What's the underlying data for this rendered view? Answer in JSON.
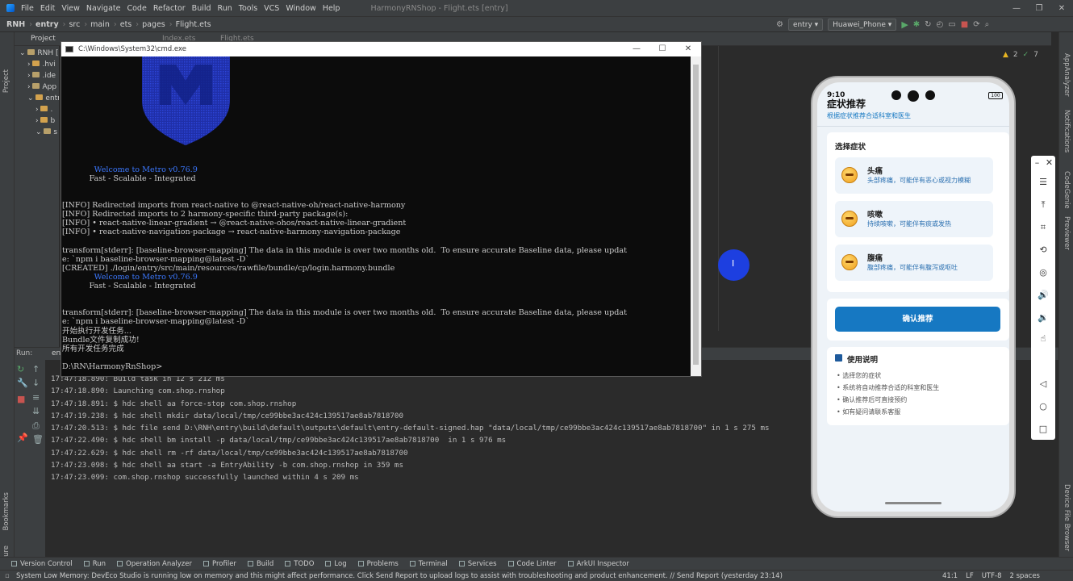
{
  "menubar": {
    "items": [
      "File",
      "Edit",
      "View",
      "Navigate",
      "Code",
      "Refactor",
      "Build",
      "Run",
      "Tools",
      "VCS",
      "Window",
      "Help"
    ],
    "title": "HarmonyRNShop - Flight.ets [entry]"
  },
  "navbar": {
    "crumbs": [
      "RNH",
      "entry",
      "src",
      "main",
      "ets",
      "pages",
      "Flight.ets"
    ],
    "module_select": "entry",
    "device_select": "Huawei_Phone"
  },
  "project": {
    "header": "Project",
    "tree": [
      "RNH [H",
      ".hvi",
      ".ide",
      "App",
      "entr",
      ".",
      "b",
      "s"
    ]
  },
  "editor": {
    "tabs": [
      "Index.ets",
      "Flight.ets"
    ],
    "warnings": "2",
    "infos": "7"
  },
  "left_stripe": {
    "project": "Project",
    "bookmarks": "Bookmarks",
    "structure": "Structure"
  },
  "right_stripe": {
    "app_analyzer": "AppAnalyzer",
    "notifications": "Notifications",
    "codegenie": "CodeGenie",
    "previewer": "Previewer",
    "device_file_browser": "Device File Browser"
  },
  "cmd": {
    "title": "C:\\Windows\\System32\\cmd.exe",
    "lines": [
      {
        "t": "             Welcome to Metro v0.76.9",
        "c": "blue"
      },
      {
        "t": "           Fast - Scalable - Integrated",
        "c": ""
      },
      {
        "t": "",
        "c": ""
      },
      {
        "t": "",
        "c": ""
      },
      {
        "t": "[INFO] Redirected imports from react-native to @react-native-oh/react-native-harmony",
        "c": ""
      },
      {
        "t": "[INFO] Redirected imports to 2 harmony-specific third-party package(s):",
        "c": ""
      },
      {
        "t": "[INFO] • react-native-linear-gradient → @react-native-ohos/react-native-linear-gradient",
        "c": ""
      },
      {
        "t": "[INFO] • react-native-navigation-package → react-native-harmony-navigation-package",
        "c": ""
      },
      {
        "t": "",
        "c": ""
      },
      {
        "t": "transform[stderr]: [baseline-browser-mapping] The data in this module is over two months old.  To ensure accurate Baseline data, please updat",
        "c": ""
      },
      {
        "t": "e: `npm i baseline-browser-mapping@latest -D`",
        "c": ""
      },
      {
        "t": "[CREATED] ./login/entry/src/main/resources/rawfile/bundle/cp/login.harmony.bundle",
        "c": ""
      },
      {
        "t": "             Welcome to Metro v0.76.9",
        "c": "blue"
      },
      {
        "t": "           Fast - Scalable - Integrated",
        "c": ""
      },
      {
        "t": "",
        "c": ""
      },
      {
        "t": "",
        "c": ""
      },
      {
        "t": "transform[stderr]: [baseline-browser-mapping] The data in this module is over two months old.  To ensure accurate Baseline data, please updat",
        "c": ""
      },
      {
        "t": "e: `npm i baseline-browser-mapping@latest -D`",
        "c": ""
      },
      {
        "t": "开始执行开发任务...",
        "c": ""
      },
      {
        "t": "Bundle文件复制成功!",
        "c": ""
      },
      {
        "t": "所有开发任务完成",
        "c": ""
      },
      {
        "t": "",
        "c": ""
      },
      {
        "t": "D:\\RN\\HarmonyRnShop>",
        "c": ""
      }
    ]
  },
  "run": {
    "label": "Run:",
    "tab": "entry",
    "log": [
      "17:47:18.890: Build task in 12 s 212 ms",
      "17:47:18.890: Launching com.shop.rnshop",
      "17:47:18.891: $ hdc shell aa force-stop com.shop.rnshop",
      "17:47:19.238: $ hdc shell mkdir data/local/tmp/ce99bbe3ac424c139517ae8ab7818700",
      "17:47:20.513: $ hdc file send D:\\RNH\\entry\\build\\default\\outputs\\default\\entry-default-signed.hap \"data/local/tmp/ce99bbe3ac424c139517ae8ab7818700\" in 1 s 275 ms",
      "17:47:22.490: $ hdc shell bm install -p data/local/tmp/ce99bbe3ac424c139517ae8ab7818700  in 1 s 976 ms",
      "17:47:22.629: $ hdc shell rm -rf data/local/tmp/ce99bbe3ac424c139517ae8ab7818700",
      "17:47:23.098: $ hdc shell aa start -a EntryAbility -b com.shop.rnshop in 359 ms",
      "17:47:23.099: com.shop.rnshop successfully launched within 4 s 209 ms"
    ]
  },
  "toolwindows": [
    "Version Control",
    "Run",
    "Operation Analyzer",
    "Profiler",
    "Build",
    "TODO",
    "Log",
    "Problems",
    "Terminal",
    "Services",
    "Code Linter",
    "ArkUI Inspector"
  ],
  "status": {
    "message": "System Low Memory: DevEco Studio is running low on memory and this might affect performance. Click Send Report to upload logs to assist with troubleshooting and product enhancement. // Send Report (yesterday 23:14)",
    "position": "41:1",
    "line_sep": "LF",
    "encoding": "UTF-8",
    "indent": "2 spaces"
  },
  "phone": {
    "time": "9:10",
    "battery": "100",
    "app_title": "症状推荐",
    "app_subtitle": "根据症状推荐合适科室和医生",
    "section_title": "选择症状",
    "symptoms": [
      {
        "name": "头痛",
        "desc": "头部疼痛，可能伴有恶心或视力模糊"
      },
      {
        "name": "咳嗽",
        "desc": "持续咳嗽，可能伴有痰或发热"
      },
      {
        "name": "腹痛",
        "desc": "腹部疼痛，可能伴有腹泻或呕吐"
      }
    ],
    "confirm_button": "确认推荐",
    "help_title": "使用说明",
    "help_items": [
      "选择您的症状",
      "系统将自动推荐合适的科室和医生",
      "确认推荐后可直接预约",
      "如有疑问请联系客服"
    ]
  },
  "colors": {
    "accent": "#1678c2",
    "ide_bg": "#2b2b2b",
    "metro_blue": "#3b78ff"
  }
}
